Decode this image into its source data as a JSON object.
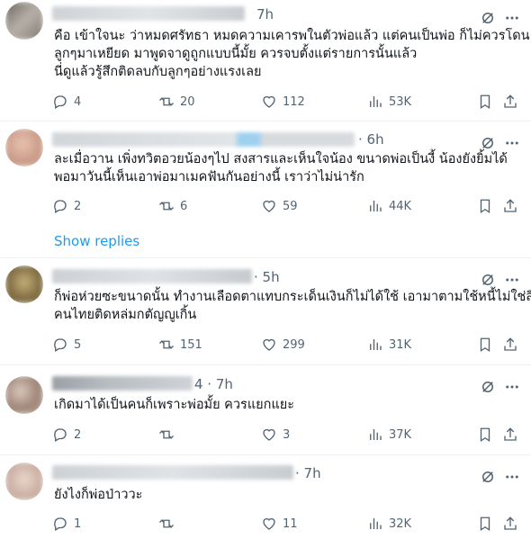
{
  "tweets": [
    {
      "time": "7h",
      "lines": [
        "คือ เข้าใจนะ ว่าหมดศรัทธา หมดความเคารพในตัวพ่อแล้ว แต่คนเป็นพ่อ ก็ไม่ควรโดน",
        "ลูกๆมาเหยียด มาพูดจาดูถูกแบบนี้มั้ย ควรจบตั้งแต่รายการนั้นแล้ว",
        "นี่ดูแล้วรู้สึกติดลบกับลูกๆอย่างแรงเลย"
      ],
      "replies": "4",
      "reposts": "20",
      "likes": "112",
      "views": "53K"
    },
    {
      "time": "· 6h",
      "lines": [
        "ละเมื่อวาน เพิ่งทวิตอวยน้องๆไป สงสารและเห็นใจน้อง ขนาดพ่อเป็นงี้ น้องยังยิ้มได้",
        "พอมาวันนี้เห็นเอาพ่อมาเมคฟันกันอย่างนี้ เราว่าไม่น่ารัก"
      ],
      "replies": "2",
      "reposts": "6",
      "likes": "59",
      "views": "44K"
    },
    {
      "time": "· 5h",
      "lines": [
        "ก็พ่อห่วยซะขนาดนั้น ทำงานเลือดตาแทบกระเด็นเงินก็ไม่ได้ใช้ เอามาตามใช้หนี้ไม่ใช่สิน",
        "คนไทยติดหล่มกตัญญูเกิ้น"
      ],
      "replies": "5",
      "reposts": "151",
      "likes": "299",
      "views": "31K"
    },
    {
      "time": "4 · 7h",
      "lines": [
        "เกิดมาได้เป็นคนก็เพราะพ่อมั้ย ควรแยกแยะ"
      ],
      "replies": "2",
      "reposts": "",
      "likes": "3",
      "views": "37K"
    },
    {
      "time": "· 7h",
      "lines": [
        "ยังไงก็พ่อป่าววะ"
      ],
      "replies": "1",
      "reposts": "",
      "likes": "11",
      "views": "32K"
    }
  ],
  "show_replies_label": "Show replies",
  "colors": {
    "muted": "#536471",
    "link": "#1d9bf0",
    "text": "#0f1419"
  },
  "icons": [
    "grok-icon",
    "more-icon",
    "reply-icon",
    "repost-icon",
    "like-icon",
    "views-icon",
    "bookmark-icon",
    "share-icon"
  ]
}
